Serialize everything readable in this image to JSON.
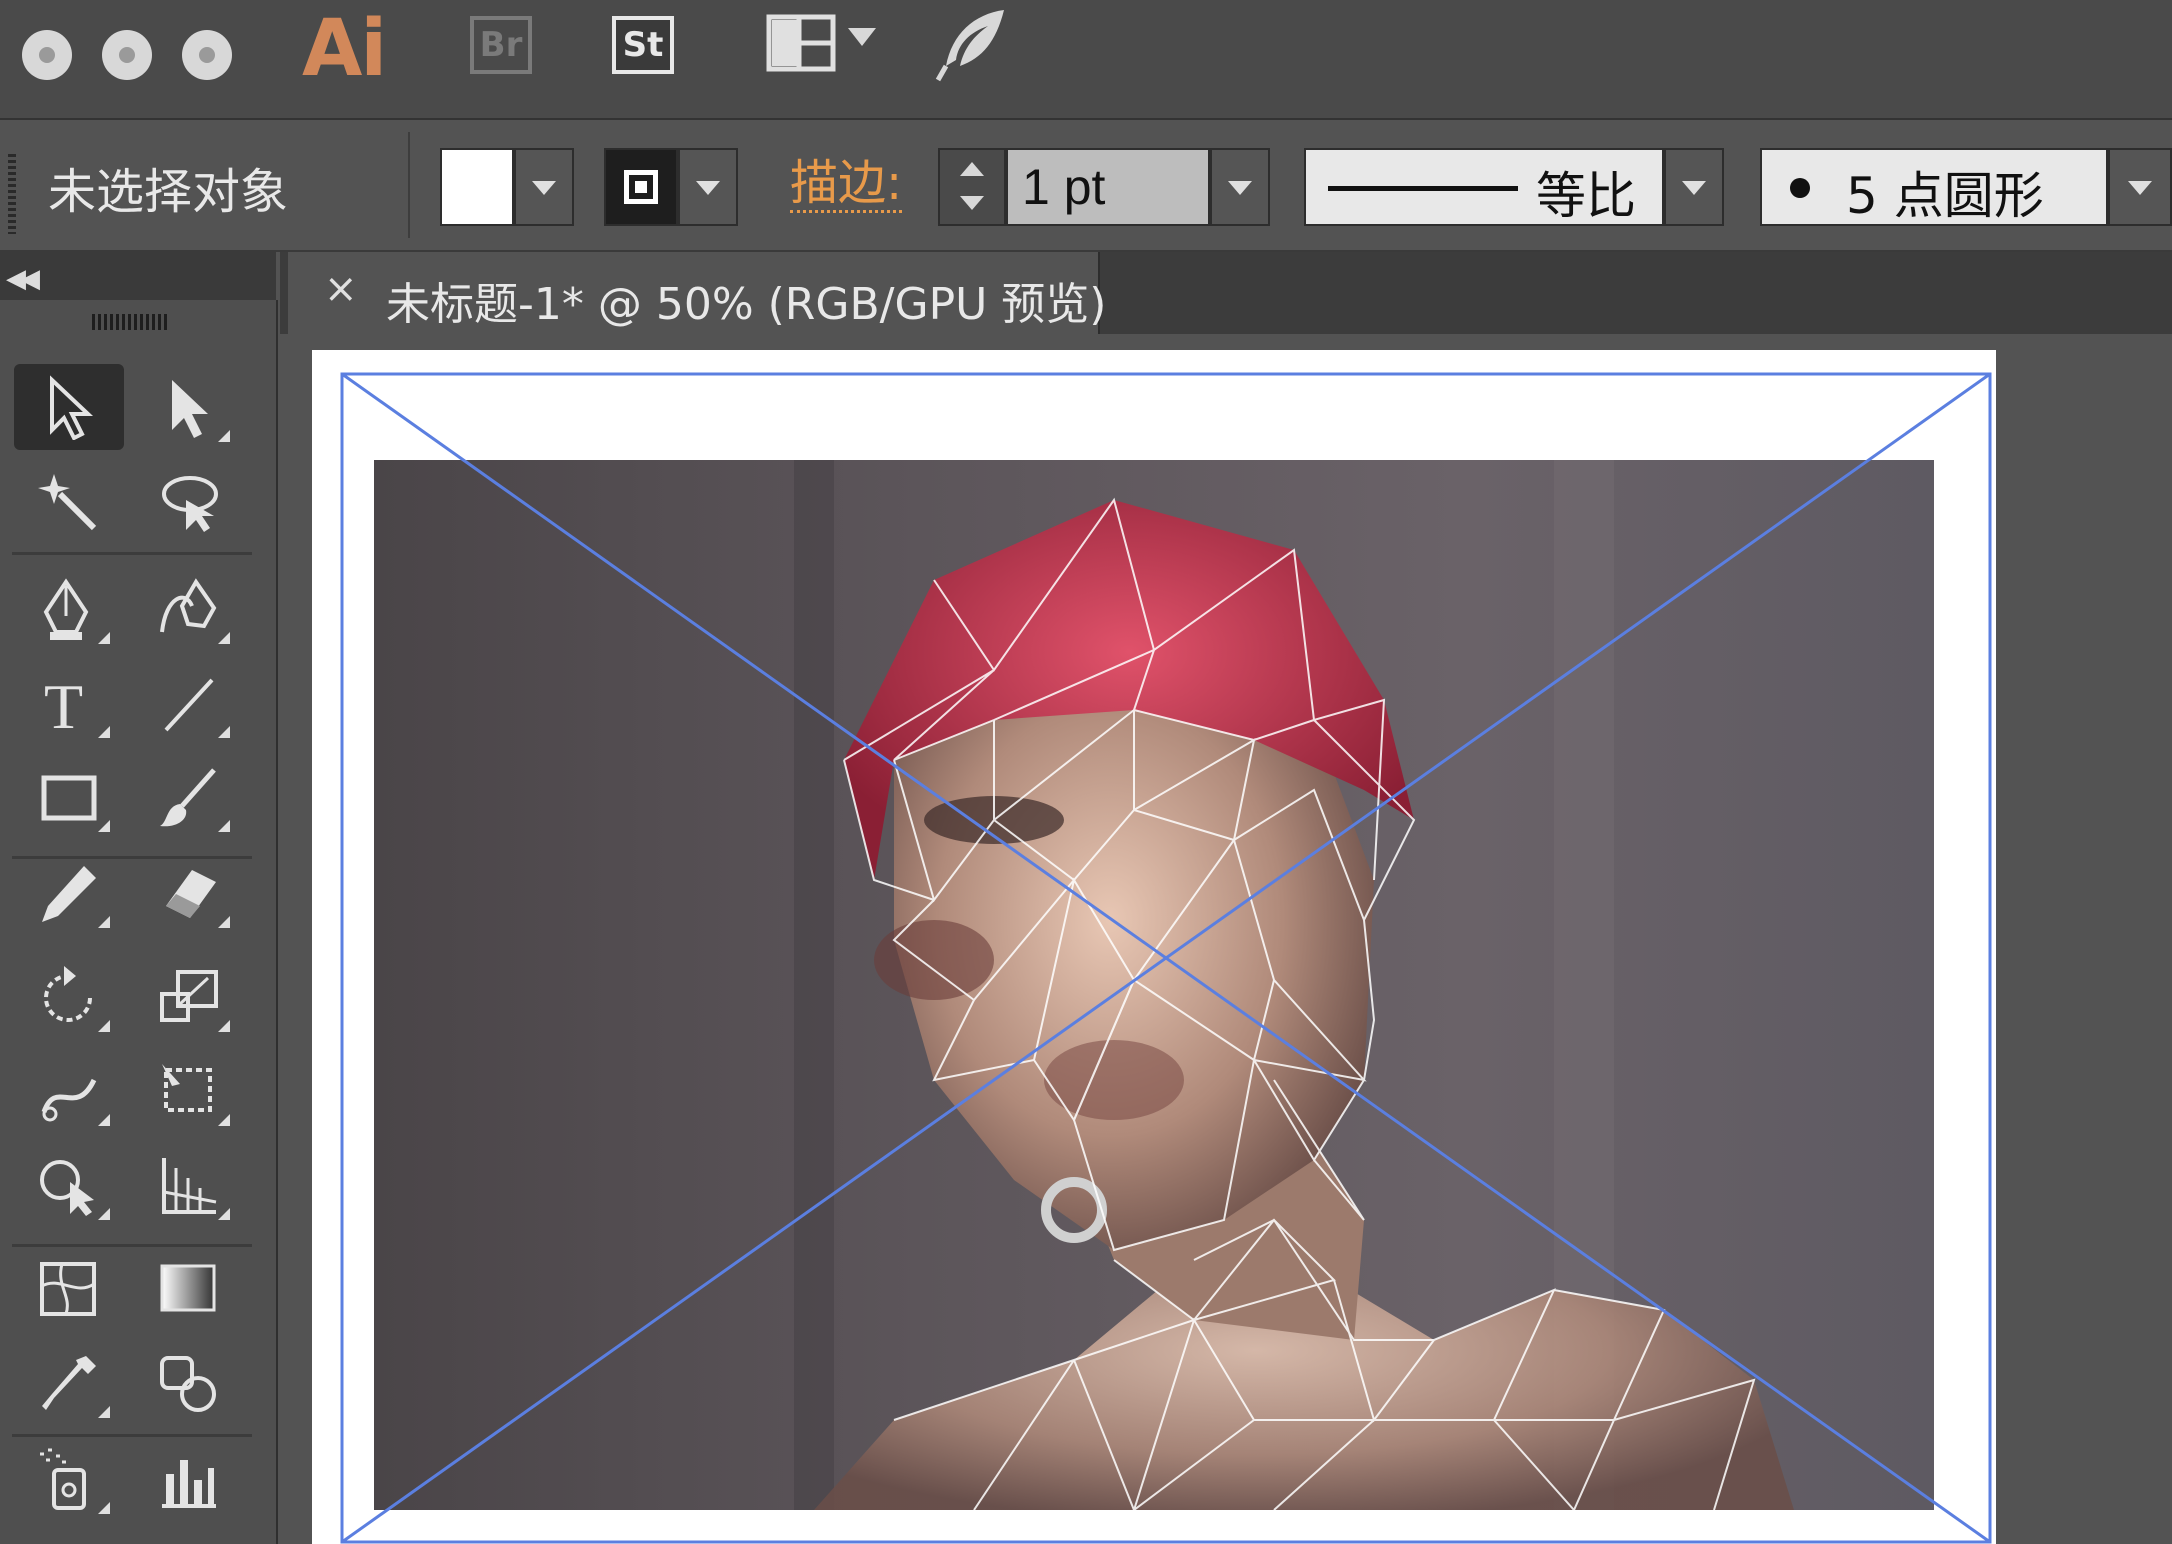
{
  "app": {
    "logo_text": "Ai",
    "bridge_label": "Br",
    "stock_label": "St"
  },
  "control_bar": {
    "selection_status": "未选择对象",
    "stroke_label": "描边:",
    "stroke_weight": "1 pt",
    "variable_width_profile": "等比",
    "brush_definition": "5 点圆形"
  },
  "document": {
    "tab_close": "×",
    "tab_title": "未标题-1* @ 50% (RGB/GPU 预览)"
  },
  "tools": [
    {
      "name": "selection-tool-icon"
    },
    {
      "name": "direct-selection-tool-icon"
    },
    {
      "name": "magic-wand-tool-icon"
    },
    {
      "name": "lasso-tool-icon"
    },
    {
      "name": "pen-tool-icon"
    },
    {
      "name": "curvature-tool-icon"
    },
    {
      "name": "type-tool-icon",
      "glyph": "T"
    },
    {
      "name": "line-segment-tool-icon"
    },
    {
      "name": "rectangle-tool-icon"
    },
    {
      "name": "paintbrush-tool-icon"
    },
    {
      "name": "pencil-tool-icon"
    },
    {
      "name": "eraser-tool-icon"
    },
    {
      "name": "rotate-tool-icon"
    },
    {
      "name": "scale-tool-icon"
    },
    {
      "name": "warp-tool-icon"
    },
    {
      "name": "free-transform-tool-icon"
    },
    {
      "name": "shape-builder-tool-icon"
    },
    {
      "name": "perspective-grid-tool-icon"
    },
    {
      "name": "mesh-tool-icon"
    },
    {
      "name": "gradient-tool-icon"
    },
    {
      "name": "eyedropper-tool-icon"
    },
    {
      "name": "blend-tool-icon"
    },
    {
      "name": "symbol-sprayer-tool-icon"
    },
    {
      "name": "column-graph-tool-icon"
    }
  ],
  "colors": {
    "app_bg": "#535353",
    "brand_orange": "#d2885a",
    "stroke_label_orange": "#e89a4a",
    "selection_blue": "#5b7fe0",
    "fill_color": "#ffffff"
  }
}
